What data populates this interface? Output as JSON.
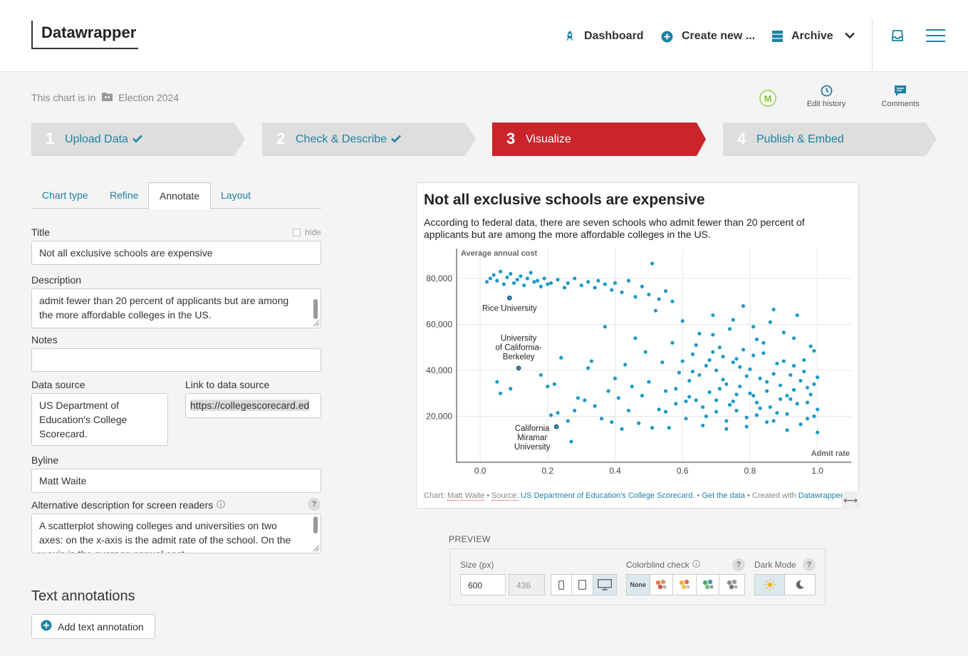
{
  "app": {
    "logo": "Datawrapper"
  },
  "nav": {
    "dashboard": "Dashboard",
    "create_new": "Create new ...",
    "archive": "Archive"
  },
  "folder": {
    "prefix": "This chart is in",
    "name": "Election 2024"
  },
  "user": {
    "avatar_initial": "M"
  },
  "tools": {
    "edit_history": "Edit history",
    "comments": "Comments"
  },
  "steps": [
    {
      "num": "1",
      "label": "Upload Data"
    },
    {
      "num": "2",
      "label": "Check & Describe"
    },
    {
      "num": "3",
      "label": "Visualize"
    },
    {
      "num": "4",
      "label": "Publish & Embed"
    }
  ],
  "tabs": [
    "Chart type",
    "Refine",
    "Annotate",
    "Layout"
  ],
  "form": {
    "title_label": "Title",
    "hide_label": "hide",
    "title_value": "Not all exclusive schools are expensive",
    "description_label": "Description",
    "description_value": "admit fewer than 20 percent of applicants but are among the more affordable colleges in the US.",
    "notes_label": "Notes",
    "notes_value": "",
    "source_label": "Data source",
    "source_value": "US Department of Education's College Scorecard.",
    "link_label": "Link to data source",
    "link_value": "https://collegescorecard.ed",
    "byline_label": "Byline",
    "byline_value": "Matt Waite",
    "alt_label": "Alternative description for screen readers",
    "alt_value": "A scatterplot showing colleges and universities on two axes: on the x-axis is the admit rate of the school. On the y-axis is the average annual cost",
    "help": "?"
  },
  "annotations": {
    "heading": "Text annotations",
    "add_button": "Add text annotation"
  },
  "chart": {
    "title": "Not all exclusive schools are expensive",
    "description": "According to federal data, there are seven schools who admit fewer than 20 percent of applicants but are among the more affordable colleges in the US.",
    "footer": {
      "chart_prefix": "Chart:",
      "author": "Matt Waite",
      "source_prefix": "Source:",
      "source": "US Department of Education's College Scorecard.",
      "get_data": "Get the data",
      "created_prefix": "Created with",
      "created_with": "Datawrapper"
    },
    "dot_color": "#1d9ac7"
  },
  "chart_data": {
    "type": "scatter",
    "title": "Not all exclusive schools are expensive",
    "xlabel": "Admit rate",
    "ylabel": "Average annual cost",
    "xlim": [
      -0.07,
      1.1
    ],
    "ylim": [
      0,
      93000
    ],
    "x_ticks": [
      0.0,
      0.2,
      0.4,
      0.6,
      0.8,
      1.0
    ],
    "x_tick_labels": [
      "0.0",
      "0.2",
      "0.4",
      "0.6",
      "0.8",
      "1.0"
    ],
    "y_ticks": [
      20000,
      40000,
      60000,
      80000
    ],
    "y_tick_labels": [
      "20,000",
      "40,000",
      "60,000",
      "80,000"
    ],
    "grid": true,
    "annotations": [
      {
        "label": "Rice University",
        "x": 0.087,
        "y": 71500
      },
      {
        "label": "University of California-Berkeley",
        "x": 0.114,
        "y": 41000
      },
      {
        "label": "California Miramar University",
        "x": 0.226,
        "y": 15500
      }
    ],
    "points": [
      [
        0.02,
        78500
      ],
      [
        0.03,
        80000
      ],
      [
        0.04,
        81500
      ],
      [
        0.05,
        79000
      ],
      [
        0.06,
        83000
      ],
      [
        0.07,
        77500
      ],
      [
        0.08,
        80500
      ],
      [
        0.09,
        82000
      ],
      [
        0.1,
        78000
      ],
      [
        0.11,
        79500
      ],
      [
        0.12,
        81000
      ],
      [
        0.13,
        77000
      ],
      [
        0.14,
        80000
      ],
      [
        0.15,
        82500
      ],
      [
        0.16,
        78500
      ],
      [
        0.17,
        79000
      ],
      [
        0.18,
        76500
      ],
      [
        0.19,
        80000
      ],
      [
        0.2,
        77500
      ],
      [
        0.21,
        78000
      ],
      [
        0.23,
        79500
      ],
      [
        0.25,
        76000
      ],
      [
        0.26,
        78000
      ],
      [
        0.28,
        80000
      ],
      [
        0.3,
        77000
      ],
      [
        0.32,
        78500
      ],
      [
        0.34,
        76000
      ],
      [
        0.35,
        79000
      ],
      [
        0.37,
        77500
      ],
      [
        0.39,
        75000
      ],
      [
        0.4,
        78000
      ],
      [
        0.42,
        74000
      ],
      [
        0.44,
        79000
      ],
      [
        0.46,
        72000
      ],
      [
        0.48,
        76500
      ],
      [
        0.5,
        73000
      ],
      [
        0.51,
        86500
      ],
      [
        0.53,
        71000
      ],
      [
        0.55,
        74500
      ],
      [
        0.57,
        70000
      ],
      [
        0.05,
        35000
      ],
      [
        0.06,
        30000
      ],
      [
        0.09,
        32000
      ],
      [
        0.18,
        38000
      ],
      [
        0.2,
        33000
      ],
      [
        0.21,
        20500
      ],
      [
        0.22,
        34000
      ],
      [
        0.23,
        21500
      ],
      [
        0.24,
        45500
      ],
      [
        0.26,
        18000
      ],
      [
        0.27,
        9000
      ],
      [
        0.28,
        22500
      ],
      [
        0.29,
        28000
      ],
      [
        0.31,
        27000
      ],
      [
        0.32,
        41000
      ],
      [
        0.33,
        44000
      ],
      [
        0.34,
        24500
      ],
      [
        0.36,
        19000
      ],
      [
        0.37,
        59000
      ],
      [
        0.38,
        31000
      ],
      [
        0.39,
        17500
      ],
      [
        0.4,
        36500
      ],
      [
        0.41,
        28000
      ],
      [
        0.42,
        14500
      ],
      [
        0.43,
        42500
      ],
      [
        0.44,
        22500
      ],
      [
        0.45,
        33000
      ],
      [
        0.46,
        54000
      ],
      [
        0.47,
        17000
      ],
      [
        0.48,
        29000
      ],
      [
        0.49,
        48000
      ],
      [
        0.5,
        35000
      ],
      [
        0.51,
        15000
      ],
      [
        0.52,
        66000
      ],
      [
        0.53,
        23000
      ],
      [
        0.54,
        43500
      ],
      [
        0.55,
        31000
      ],
      [
        0.56,
        15000
      ],
      [
        0.57,
        52000
      ],
      [
        0.58,
        25500
      ],
      [
        0.59,
        39000
      ],
      [
        0.6,
        61500
      ],
      [
        0.61,
        19000
      ],
      [
        0.62,
        35500
      ],
      [
        0.63,
        47000
      ],
      [
        0.64,
        27000
      ],
      [
        0.65,
        56000
      ],
      [
        0.66,
        16000
      ],
      [
        0.67,
        42000
      ],
      [
        0.68,
        30500
      ],
      [
        0.69,
        64000
      ],
      [
        0.7,
        22000
      ],
      [
        0.71,
        50000
      ],
      [
        0.72,
        36000
      ],
      [
        0.73,
        14500
      ],
      [
        0.74,
        58000
      ],
      [
        0.75,
        26500
      ],
      [
        0.76,
        45000
      ],
      [
        0.77,
        33000
      ],
      [
        0.78,
        68000
      ],
      [
        0.79,
        19500
      ],
      [
        0.8,
        40500
      ],
      [
        0.81,
        29000
      ],
      [
        0.82,
        53500
      ],
      [
        0.83,
        23500
      ],
      [
        0.84,
        47500
      ],
      [
        0.85,
        35000
      ],
      [
        0.86,
        61000
      ],
      [
        0.87,
        18000
      ],
      [
        0.88,
        43000
      ],
      [
        0.89,
        27500
      ],
      [
        0.9,
        56500
      ],
      [
        0.91,
        21000
      ],
      [
        0.92,
        38000
      ],
      [
        0.93,
        31500
      ],
      [
        0.94,
        64000
      ],
      [
        0.95,
        16500
      ],
      [
        0.96,
        44500
      ],
      [
        0.97,
        26000
      ],
      [
        0.98,
        50500
      ],
      [
        0.99,
        20000
      ],
      [
        1.0,
        37000
      ],
      [
        0.62,
        28500
      ],
      [
        0.65,
        38000
      ],
      [
        0.68,
        44500
      ],
      [
        0.71,
        32000
      ],
      [
        0.74,
        25000
      ],
      [
        0.77,
        41500
      ],
      [
        0.8,
        30000
      ],
      [
        0.83,
        36500
      ],
      [
        0.86,
        24000
      ],
      [
        0.89,
        33500
      ],
      [
        0.92,
        27500
      ],
      [
        0.95,
        35500
      ],
      [
        0.98,
        29500
      ],
      [
        0.66,
        24000
      ],
      [
        0.7,
        40000
      ],
      [
        0.73,
        34000
      ],
      [
        0.76,
        29500
      ],
      [
        0.79,
        37500
      ],
      [
        0.82,
        26000
      ],
      [
        0.85,
        31000
      ],
      [
        0.88,
        21500
      ],
      [
        0.91,
        29000
      ],
      [
        0.94,
        25500
      ],
      [
        0.97,
        32500
      ],
      [
        1.0,
        23000
      ],
      [
        0.72,
        46000
      ],
      [
        0.78,
        49000
      ],
      [
        0.84,
        52000
      ],
      [
        0.9,
        44000
      ],
      [
        0.96,
        39500
      ],
      [
        0.6,
        44000
      ],
      [
        0.64,
        51000
      ],
      [
        0.69,
        55500
      ],
      [
        0.75,
        62000
      ],
      [
        0.81,
        59000
      ],
      [
        0.87,
        66500
      ],
      [
        0.93,
        54000
      ],
      [
        0.99,
        48500
      ],
      [
        0.58,
        32000
      ],
      [
        0.61,
        26500
      ],
      [
        0.67,
        20000
      ],
      [
        0.73,
        18000
      ],
      [
        0.79,
        15500
      ],
      [
        0.85,
        17500
      ],
      [
        0.91,
        14000
      ],
      [
        0.97,
        19000
      ],
      [
        1.0,
        13000
      ],
      [
        0.55,
        22000
      ],
      [
        0.63,
        39500
      ],
      [
        0.69,
        48000
      ],
      [
        0.75,
        43500
      ],
      [
        0.81,
        46500
      ],
      [
        0.87,
        38500
      ],
      [
        0.93,
        42000
      ],
      [
        0.99,
        34000
      ],
      [
        0.7,
        27000
      ],
      [
        0.76,
        22500
      ],
      [
        0.82,
        20500
      ]
    ]
  },
  "preview": {
    "label": "PREVIEW",
    "size_label": "Size (px)",
    "width": "600",
    "height": "436",
    "colorblind_label": "Colorblind check",
    "colorblind_none": "None",
    "dark_label": "Dark Mode"
  }
}
